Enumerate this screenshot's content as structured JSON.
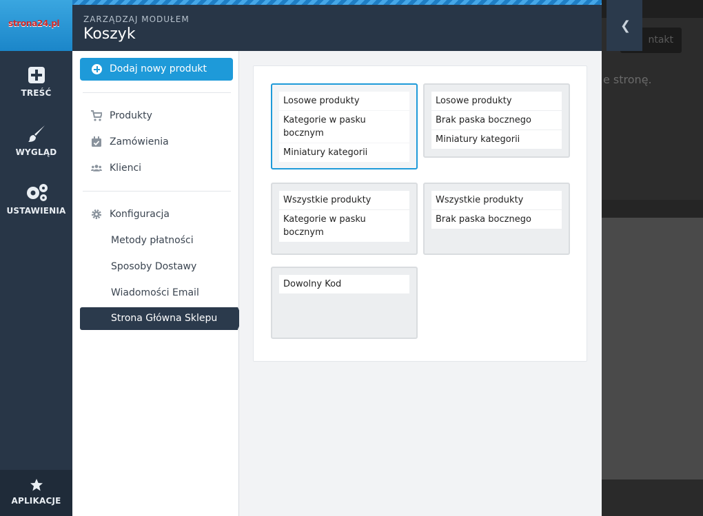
{
  "brand": {
    "logo_text": "strona24.pl"
  },
  "rail": {
    "items": [
      {
        "label": "TREŚĆ",
        "icon": "plus-square-icon"
      },
      {
        "label": "WYGLĄD",
        "icon": "brush-icon"
      },
      {
        "label": "USTAWIENIA",
        "icon": "gears-icon"
      }
    ],
    "bottom": {
      "label": "APLIKACJE",
      "icon": "star-icon"
    }
  },
  "header": {
    "subtitle": "ZARZĄDZAJ MODUŁEM",
    "title": "Koszyk"
  },
  "menu": {
    "add_button": "Dodaj nowy produkt",
    "items": [
      {
        "label": "Produkty",
        "icon": "cart-icon"
      },
      {
        "label": "Zamówienia",
        "icon": "calendar-check-icon"
      },
      {
        "label": "Klienci",
        "icon": "users-icon"
      }
    ],
    "config": {
      "label": "Konfiguracja",
      "icon": "gear-icon"
    },
    "sub_items": [
      {
        "label": "Metody płatności"
      },
      {
        "label": "Sposoby Dostawy"
      },
      {
        "label": "Wiadomości Email"
      },
      {
        "label": "Strona Główna Sklepu"
      }
    ]
  },
  "layouts": [
    {
      "rows": [
        "Losowe produkty",
        "Kategorie w pasku bocznym",
        "Miniatury kategorii"
      ],
      "selected": true
    },
    {
      "rows": [
        "Losowe produkty",
        "Brak paska bocznego",
        "Miniatury kategorii"
      ],
      "selected": false
    },
    {
      "rows": [
        "Wszystkie produkty",
        "Kategorie w pasku bocznym"
      ],
      "selected": false
    },
    {
      "rows": [
        "Wszystkie produkty",
        "Brak paska bocznego"
      ],
      "selected": false
    },
    {
      "rows": [
        "Dowolny Kod"
      ],
      "selected": false
    }
  ],
  "backdrop": {
    "button_fragment": "ntakt",
    "text_fragment": "e stronę."
  },
  "colors": {
    "accent": "#1e9ad9",
    "dark": "#283647",
    "active": "#2b3a4c"
  }
}
